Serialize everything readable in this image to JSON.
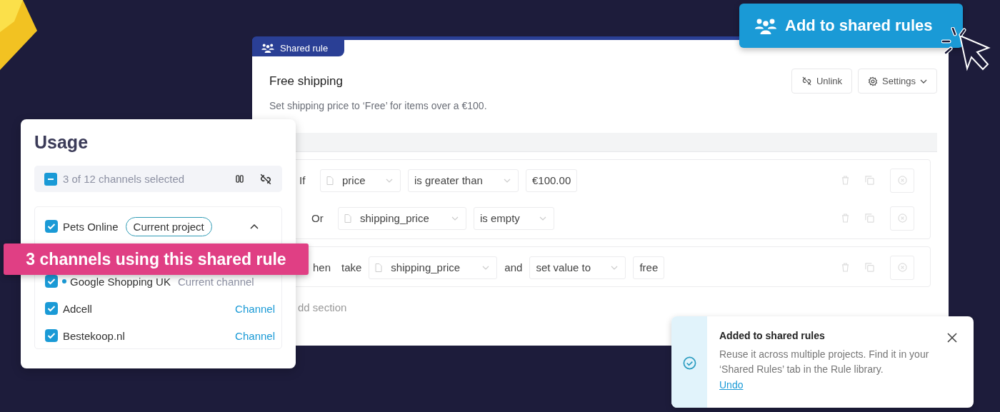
{
  "hero_button": {
    "label": "Add to shared rules"
  },
  "rule_panel": {
    "tab": "Shared rule",
    "title": "Free shipping",
    "description": "Set shipping price to ‘Free’ for items over a €100.",
    "buttons": [
      {
        "label": "Unlink",
        "kind": "unlink"
      },
      {
        "label": "Settings",
        "kind": "settings"
      }
    ],
    "conditions": [
      {
        "connector": "If",
        "field": "price",
        "operator": "is greater than",
        "value": "€100.00"
      },
      {
        "connector": "Or",
        "field": "shipping_price",
        "operator": "is empty"
      }
    ],
    "action": {
      "connector": "hen",
      "verb": "take",
      "field": "shipping_price",
      "joiner": "and",
      "operator": "set value to",
      "value": "free"
    },
    "add_section": "dd section"
  },
  "usage": {
    "title": "Usage",
    "selection": {
      "label": "3 of 12 channels selected",
      "indeterminate": true
    },
    "project": {
      "name": "Pets Online",
      "badge": "Current project",
      "checked": true,
      "expanded": true
    },
    "channels": [
      {
        "name": "Google Shopping UK",
        "tag": "Current channel",
        "checked": true,
        "current": true
      },
      {
        "name": "Adcell",
        "tag": "Channel",
        "checked": true,
        "current": false
      },
      {
        "name": "Bestekoop.nl",
        "tag": "Channel",
        "checked": true,
        "current": false
      }
    ]
  },
  "banner": "3 channels using this shared rule",
  "toast": {
    "title": "Added to shared rules",
    "message": "Reuse it across multiple projects. Find it in your ‘Shared Rules’ tab in the Rule library.",
    "link": "Undo"
  }
}
